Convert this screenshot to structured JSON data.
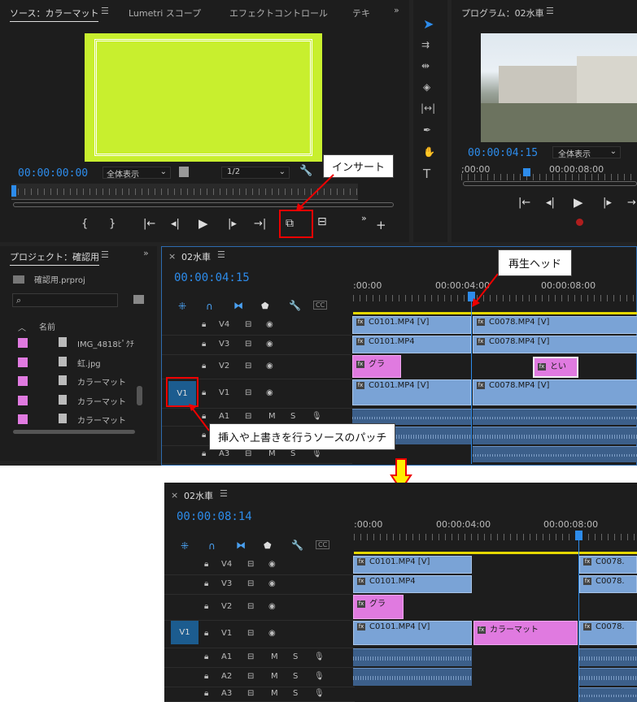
{
  "source_panel": {
    "tab_source": "ソース：カラーマット",
    "tab_lumetri": "Lumetri スコープ",
    "tab_effect": "エフェクトコントロール",
    "tab_text": "テキ",
    "timecode": "00:00:00:00",
    "zoom": "全体表示",
    "resolution": "1/2",
    "frame_color": "#c8ef2e"
  },
  "program_panel": {
    "title": "プログラム：02水車",
    "timecode": "00:00:04:15",
    "zoom": "全体表示",
    "ruler_start": ";00:00",
    "ruler_mid": "00:00:08:00"
  },
  "project_panel": {
    "title": "プロジェクト：確認用",
    "file": "確認用.prproj",
    "col_name": "名前",
    "items": [
      "IMG_4818ﾋﾟｸﾁ",
      "虹.jpg",
      "カラーマット",
      "カラーマット",
      "カラーマット"
    ]
  },
  "timeline_top": {
    "tab": "02水車",
    "timecode": "00:00:04:15",
    "r0": ":00:00",
    "r1": "00:00:04:00",
    "r2": "00:00:08:00",
    "tracks": [
      "V4",
      "V3",
      "V2",
      "V1",
      "A1",
      "A2",
      "A3"
    ],
    "source_patch": "V1",
    "m_label": "M",
    "s_label": "S",
    "clips": {
      "v4a": "C0101.MP4 [V]",
      "v4b": "C0078.MP4 [V]",
      "v3a": "C0101.MP4",
      "v3b": "C0078.MP4 [V]",
      "v2a": "グラ",
      "v2b": "とい",
      "v1a": "C0101.MP4 [V]",
      "v1b": "C0078.MP4 [V]"
    }
  },
  "timeline_bottom": {
    "tab": "02水車",
    "timecode": "00:00:08:14",
    "r0": ":00:00",
    "r1": "00:00:04:00",
    "r2": "00:00:08:00",
    "tracks": [
      "V4",
      "V3",
      "V2",
      "V1",
      "A1",
      "A2",
      "A3"
    ],
    "source_patch": "V1",
    "m_label": "M",
    "s_label": "S",
    "clips": {
      "v4a": "C0101.MP4 [V]",
      "v4b": "C0078.",
      "v3a": "C0101.MP4",
      "v3b": "C0078.",
      "v2a": "グラ",
      "v1a": "C0101.MP4 [V]",
      "v1m": "カラーマット",
      "v1b": "C0078."
    }
  },
  "callouts": {
    "insert": "インサート",
    "playhead": "再生ヘッド",
    "patch": "挿入や上書きを行うソースのパッチ"
  },
  "fx_label": "fx",
  "colors": {
    "accent": "#2d8ceb",
    "clip_video": "#7aa3d6",
    "clip_pink": "#e07ae0",
    "callout_border": "#e00000",
    "arrow": "#ffee00"
  }
}
